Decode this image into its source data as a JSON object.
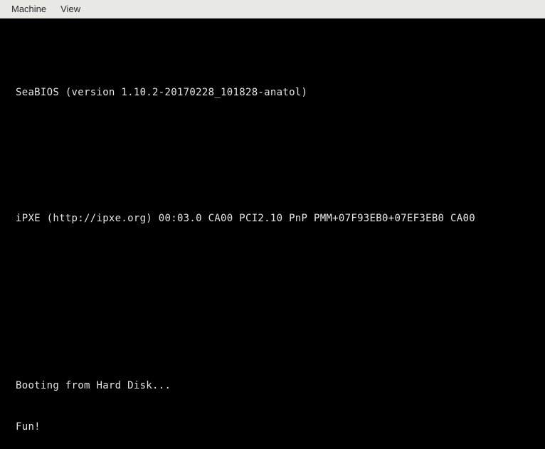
{
  "menubar": {
    "items": [
      {
        "label": "Machine"
      },
      {
        "label": "View"
      }
    ]
  },
  "terminal": {
    "lines": [
      "SeaBIOS (version 1.10.2-20170228_101828-anatol)",
      "",
      "",
      "iPXE (http://ipxe.org) 00:03.0 CA00 PCI2.10 PnP PMM+07F93EB0+07EF3EB0 CA00",
      "",
      "",
      "",
      "Booting from Hard Disk...",
      "Fun!"
    ]
  }
}
